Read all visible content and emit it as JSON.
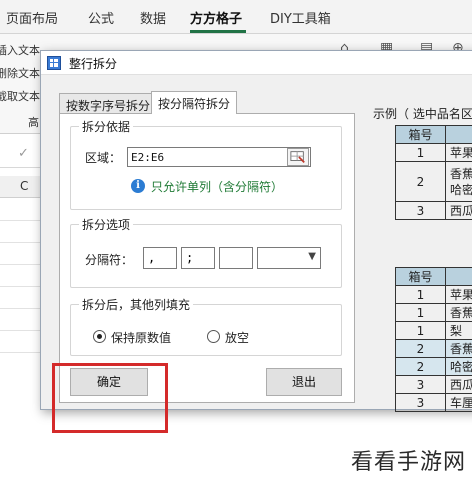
{
  "ribbon": {
    "tabs": [
      "页面布局",
      "公式",
      "数据",
      "方方格子",
      "DIY工具箱"
    ],
    "left_items": [
      "插入文本",
      "删除文本",
      "截取文本"
    ],
    "partial_label": "高"
  },
  "sheet": {
    "column_letter": "C"
  },
  "dialog": {
    "title": "整行拆分",
    "tabs": [
      "按数字序号拆分",
      "按分隔符拆分"
    ],
    "basis_group": {
      "title": "拆分依据",
      "range_label": "区域：",
      "range_value": "E2:E6",
      "hint": "只允许单列（含分隔符）"
    },
    "options_group": {
      "title": "拆分选项",
      "separator_label": "分隔符：",
      "separators": [
        ",",
        ";",
        ""
      ],
      "combo_value": ""
    },
    "fill_group": {
      "title": "拆分后，其他列填充",
      "option_keep": "保持原数值",
      "option_empty": "放空",
      "selected": "保持原数值"
    },
    "ok_label": "确定",
    "exit_label": "退出"
  },
  "example": {
    "title": "示例（ 选中品名区",
    "table1_header": "箱号",
    "table1_rows": [
      {
        "num": "1",
        "name": "苹果"
      },
      {
        "num": "2",
        "name": "香蕉 哈密"
      },
      {
        "num": "3",
        "name": "西瓜"
      }
    ],
    "table2_header": "箱号",
    "table2_rows": [
      {
        "num": "1",
        "name": "苹果"
      },
      {
        "num": "1",
        "name": "香蕉"
      },
      {
        "num": "1",
        "name": "梨"
      },
      {
        "num": "2",
        "name": "香蕉"
      },
      {
        "num": "2",
        "name": "哈密"
      },
      {
        "num": "3",
        "name": "西瓜"
      },
      {
        "num": "3",
        "name": "车厘"
      }
    ]
  },
  "watermark": "看看手游网",
  "colors": {
    "accent_green": "#217346",
    "highlight_red": "#d42a2a",
    "table_header": "#b9d1de",
    "hint_green": "#1f7a35"
  }
}
